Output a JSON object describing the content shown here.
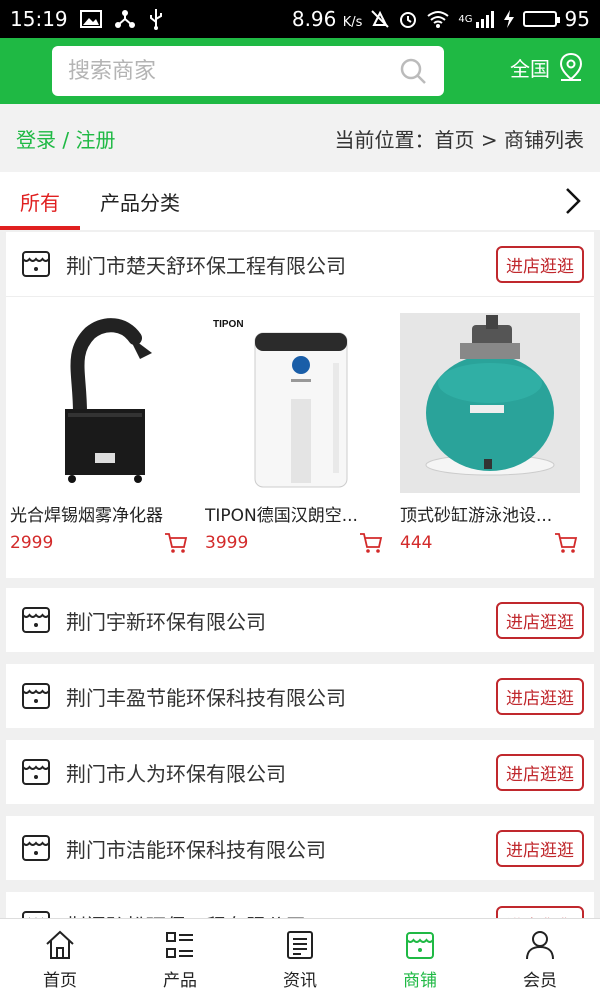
{
  "status_bar": {
    "time": "15:19",
    "speed": "8.96",
    "speed_unit": "K/s",
    "network": "4G",
    "battery": "95"
  },
  "header": {
    "search_placeholder": "搜索商家",
    "region_label": "全国"
  },
  "breadcrumb": {
    "login_label": "登录 / 注册",
    "location_label": "当前位置：首页 > 商铺列表"
  },
  "tabs": [
    {
      "label": "所有"
    },
    {
      "label": "产品分类"
    }
  ],
  "shops": [
    {
      "name": "荆门市楚天舒环保工程有限公司",
      "visit_label": "进店逛逛",
      "products": [
        {
          "name": "光合焊锡烟雾净化器",
          "price": "2999",
          "image": "fume-extractor"
        },
        {
          "name": "TIPON德国汉朗空...",
          "price": "3999",
          "image": "air-purifier",
          "brand_text": "TIPON"
        },
        {
          "name": "顶式砂缸游泳池设...",
          "price": "444",
          "image": "sand-filter-tank"
        }
      ]
    },
    {
      "name": "荆门宇新环保有限公司",
      "visit_label": "进店逛逛"
    },
    {
      "name": "荆门丰盈节能环保科技有限公司",
      "visit_label": "进店逛逛"
    },
    {
      "name": "荆门市人为环保有限公司",
      "visit_label": "进店逛逛"
    },
    {
      "name": "荆门市洁能环保科技有限公司",
      "visit_label": "进店逛逛"
    },
    {
      "name": "荆门弘松环保工程有限公司",
      "visit_label": "进店逛逛"
    }
  ],
  "bottom_nav": [
    {
      "label": "首页",
      "icon": "home-icon"
    },
    {
      "label": "产品",
      "icon": "product-list-icon"
    },
    {
      "label": "资讯",
      "icon": "news-icon"
    },
    {
      "label": "商铺",
      "icon": "shop-icon",
      "active": true
    },
    {
      "label": "会员",
      "icon": "member-icon"
    }
  ],
  "colors": {
    "brand_green": "#1fb944",
    "accent_red": "#e02020",
    "price_red": "#d32a2a"
  }
}
